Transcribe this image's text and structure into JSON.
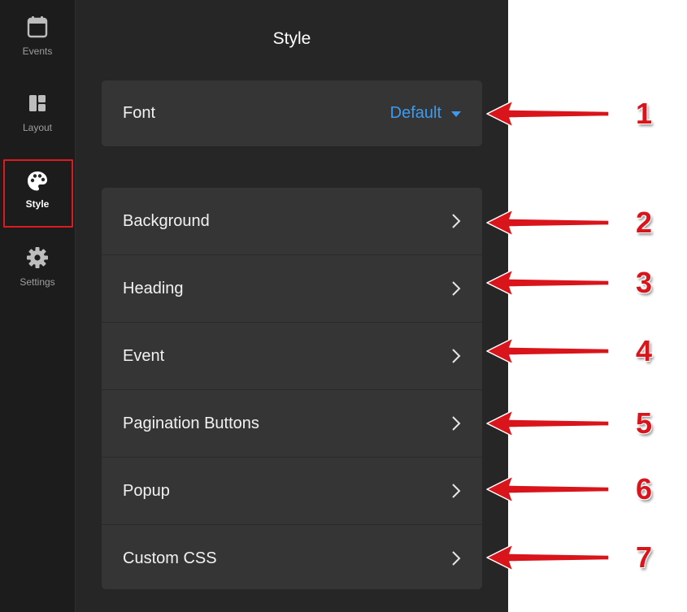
{
  "rail": {
    "items": [
      {
        "label": "Events",
        "icon": "calendar-icon"
      },
      {
        "label": "Layout",
        "icon": "layout-icon"
      },
      {
        "label": "Style",
        "icon": "palette-icon",
        "active": true
      },
      {
        "label": "Settings",
        "icon": "gear-icon"
      }
    ]
  },
  "panel": {
    "title": "Style",
    "font": {
      "label": "Font",
      "value": "Default"
    },
    "items": [
      {
        "label": "Background"
      },
      {
        "label": "Heading"
      },
      {
        "label": "Event"
      },
      {
        "label": "Pagination Buttons"
      },
      {
        "label": "Popup"
      },
      {
        "label": "Custom CSS"
      }
    ]
  },
  "annotations": [
    "1",
    "2",
    "3",
    "4",
    "5",
    "6",
    "7"
  ],
  "colors": {
    "accent": "#3c9bf0",
    "annotation": "#d9141a",
    "highlight_border": "#e0191f",
    "panel_bg": "#262626",
    "card_bg": "#353535",
    "rail_bg": "#1c1c1c"
  }
}
